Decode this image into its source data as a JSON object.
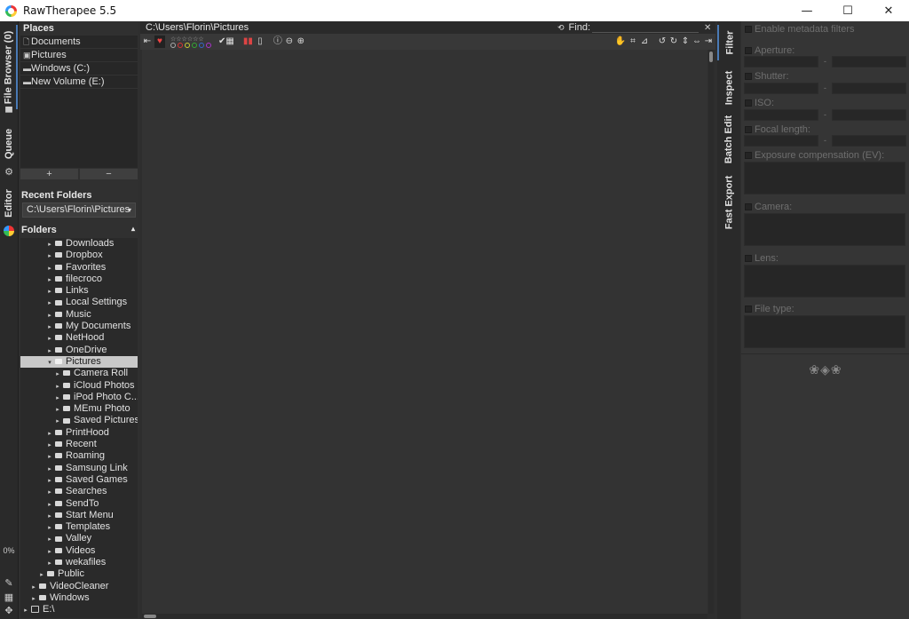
{
  "window": {
    "title": "RawTherapee 5.5",
    "controls": [
      "—",
      "☐",
      "✕"
    ]
  },
  "left_tabs": {
    "file_browser": "File Browser (0)",
    "queue": "Queue",
    "editor": "Editor",
    "progress": "0%"
  },
  "places": {
    "header": "Places",
    "items": [
      {
        "icon": "🗋",
        "label": "Documents"
      },
      {
        "icon": "▣",
        "label": "Pictures"
      },
      {
        "icon": "▬",
        "label": "Windows (C:)"
      },
      {
        "icon": "▬",
        "label": "New Volume (E:)"
      }
    ],
    "add_label": "+",
    "remove_label": "−"
  },
  "recent": {
    "header": "Recent Folders",
    "selected": "C:\\Users\\Florin\\Pictures"
  },
  "folders": {
    "header": "Folders",
    "items": [
      {
        "label": "Downloads",
        "depth": 3,
        "expanded": false
      },
      {
        "label": "Dropbox",
        "depth": 3,
        "expanded": false
      },
      {
        "label": "Favorites",
        "depth": 3,
        "expanded": false
      },
      {
        "label": "filecroco",
        "depth": 3,
        "expanded": false
      },
      {
        "label": "Links",
        "depth": 3,
        "expanded": false
      },
      {
        "label": "Local Settings",
        "depth": 3,
        "expanded": false
      },
      {
        "label": "Music",
        "depth": 3,
        "expanded": false
      },
      {
        "label": "My Documents",
        "depth": 3,
        "expanded": false
      },
      {
        "label": "NetHood",
        "depth": 3,
        "expanded": false
      },
      {
        "label": "OneDrive",
        "depth": 3,
        "expanded": false
      },
      {
        "label": "Pictures",
        "depth": 3,
        "expanded": true,
        "selected": true
      },
      {
        "label": "Camera Roll",
        "depth": 4,
        "expanded": false
      },
      {
        "label": "iCloud Photos",
        "depth": 4,
        "expanded": false
      },
      {
        "label": "iPod Photo C...",
        "depth": 4,
        "expanded": false
      },
      {
        "label": "MEmu Photo",
        "depth": 4,
        "expanded": false
      },
      {
        "label": "Saved Pictures",
        "depth": 4,
        "expanded": false
      },
      {
        "label": "PrintHood",
        "depth": 3,
        "expanded": false
      },
      {
        "label": "Recent",
        "depth": 3,
        "expanded": false
      },
      {
        "label": "Roaming",
        "depth": 3,
        "expanded": false
      },
      {
        "label": "Samsung Link",
        "depth": 3,
        "expanded": false
      },
      {
        "label": "Saved Games",
        "depth": 3,
        "expanded": false
      },
      {
        "label": "Searches",
        "depth": 3,
        "expanded": false
      },
      {
        "label": "SendTo",
        "depth": 3,
        "expanded": false
      },
      {
        "label": "Start Menu",
        "depth": 3,
        "expanded": false
      },
      {
        "label": "Templates",
        "depth": 3,
        "expanded": false
      },
      {
        "label": "Valley",
        "depth": 3,
        "expanded": false
      },
      {
        "label": "Videos",
        "depth": 3,
        "expanded": false
      },
      {
        "label": "wekafiles",
        "depth": 3,
        "expanded": false
      },
      {
        "label": "Public",
        "depth": 2,
        "expanded": false
      },
      {
        "label": "VideoCleaner",
        "depth": 1,
        "expanded": false
      },
      {
        "label": "Windows",
        "depth": 1,
        "expanded": false
      },
      {
        "label": "E:\\",
        "depth": 0,
        "expanded": false,
        "drive": true
      }
    ]
  },
  "browser": {
    "path": "C:\\Users\\Florin\\Pictures",
    "find_label": "Find:",
    "find_value": "",
    "stars": "☆☆☆☆☆☆"
  },
  "right_tabs": {
    "filter": "Filter",
    "inspect": "Inspect",
    "batch_edit": "Batch Edit",
    "fast_export": "Fast Export"
  },
  "filter_panel": {
    "enable_metadata": "Enable metadata filters",
    "aperture": "Aperture:",
    "shutter": "Shutter:",
    "iso": "ISO:",
    "focal_length": "Focal length:",
    "exposure_comp": "Exposure compensation (EV):",
    "camera": "Camera:",
    "lens": "Lens:",
    "file_type": "File type:",
    "range_sep": "-",
    "ornament": "❀◈❀"
  },
  "colors": {
    "accent": "#4a7ab5",
    "panel": "#353535",
    "selected_row": "#c8c8c8"
  }
}
